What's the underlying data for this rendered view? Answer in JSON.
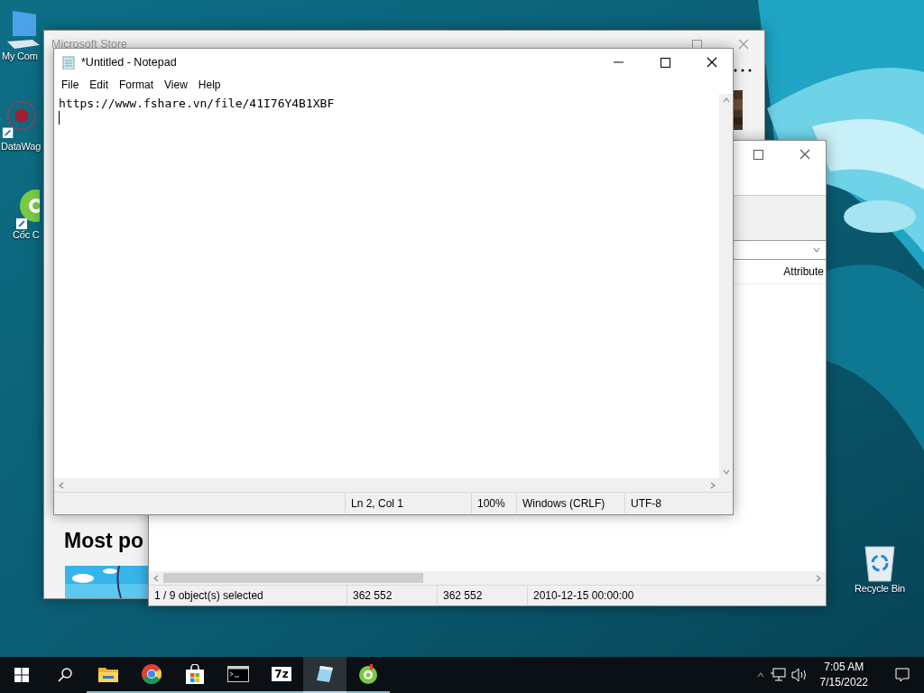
{
  "desktop": {
    "icons": [
      {
        "kind": "computer",
        "label": "My Com"
      },
      {
        "kind": "network",
        "label": "DataWag"
      },
      {
        "kind": "browser",
        "label": "Cốc C"
      },
      {
        "kind": "recycle",
        "label": "Recycle Bin"
      }
    ]
  },
  "store_window": {
    "title": "Microsoft Store",
    "heading": "Most po"
  },
  "archive_window": {
    "columns": [
      "Attribute"
    ],
    "status_bar": [
      "1 / 9 object(s) selected",
      "362 552",
      "362 552",
      "2010-12-15 00:00:00"
    ]
  },
  "notepad": {
    "title": "*Untitled - Notepad",
    "menu": [
      "File",
      "Edit",
      "Format",
      "View",
      "Help"
    ],
    "text": "https://www.fshare.vn/file/41I76Y4B1XBF",
    "status_bar": [
      "Ln 2, Col 1",
      "100%",
      "Windows (CRLF)",
      "UTF-8"
    ]
  },
  "taskbar": {
    "apps": [
      {
        "kind": "folder",
        "selected": false
      },
      {
        "kind": "chrome",
        "selected": false
      },
      {
        "kind": "store",
        "selected": false
      },
      {
        "kind": "terminal",
        "selected": false
      },
      {
        "kind": "sevenzip",
        "label": "7z",
        "selected": false
      },
      {
        "kind": "notepad",
        "selected": true
      },
      {
        "kind": "coccoc",
        "selected": false
      }
    ],
    "time": "7:05 AM",
    "date": "7/15/2022"
  }
}
